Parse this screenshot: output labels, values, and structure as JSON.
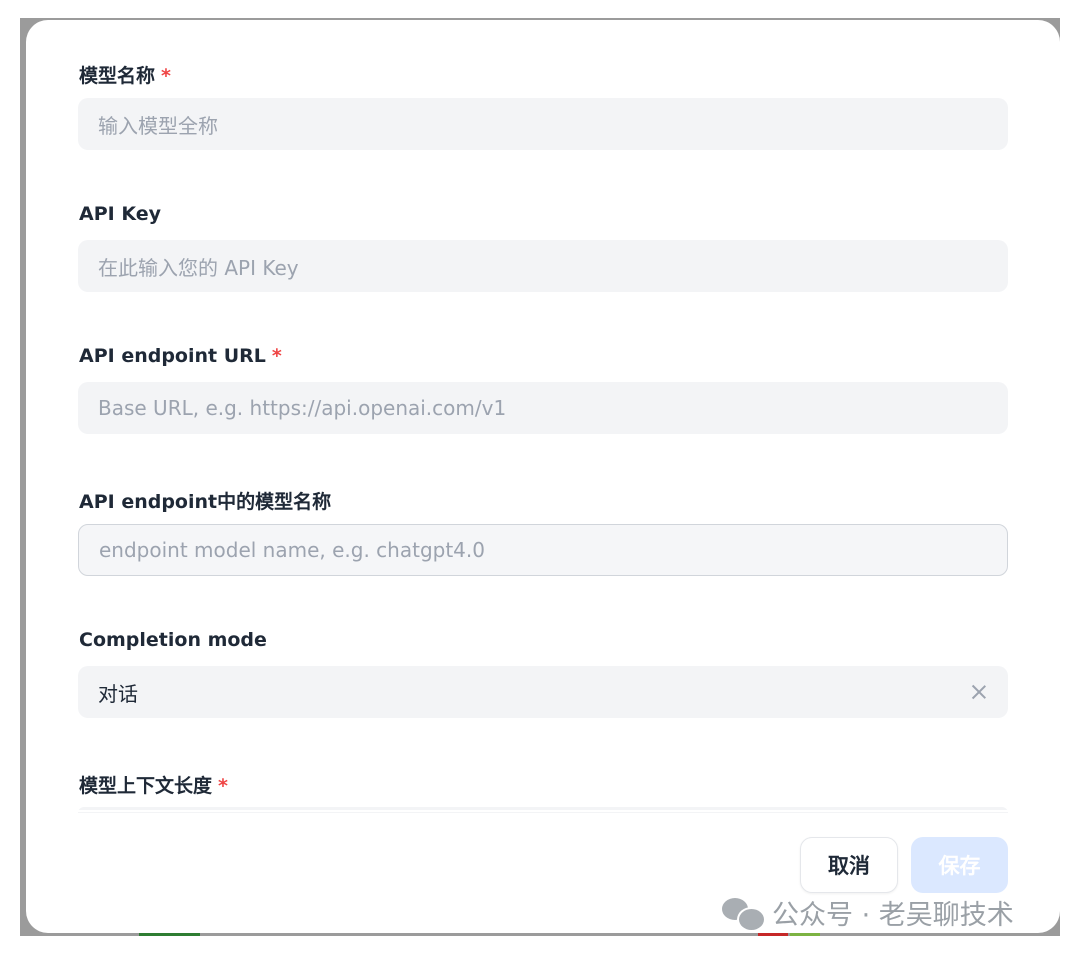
{
  "form": {
    "model_name": {
      "label": "模型名称",
      "required_mark": "*",
      "placeholder": "输入模型全称"
    },
    "api_key": {
      "label": "API Key",
      "placeholder": "在此输入您的 API Key"
    },
    "endpoint_url": {
      "label": "API endpoint URL",
      "required_mark": "*",
      "placeholder": "Base URL, e.g. https://api.openai.com/v1"
    },
    "endpoint_model_name": {
      "label": "API endpoint中的模型名称",
      "placeholder": "endpoint model name, e.g. chatgpt4.0"
    },
    "completion_mode": {
      "label": "Completion mode",
      "value": "对话"
    },
    "context_length": {
      "label": "模型上下文长度",
      "required_mark": "*"
    }
  },
  "footer": {
    "cancel_label": "取消",
    "save_label": "保存"
  },
  "watermark": {
    "text": "公众号 · 老吴聊技术"
  },
  "colors": {
    "required": "#ef4444",
    "input_bg": "#f3f4f6",
    "save_disabled": "#dbe8ff",
    "text": "#1f2937",
    "placeholder": "#9ca3af"
  }
}
